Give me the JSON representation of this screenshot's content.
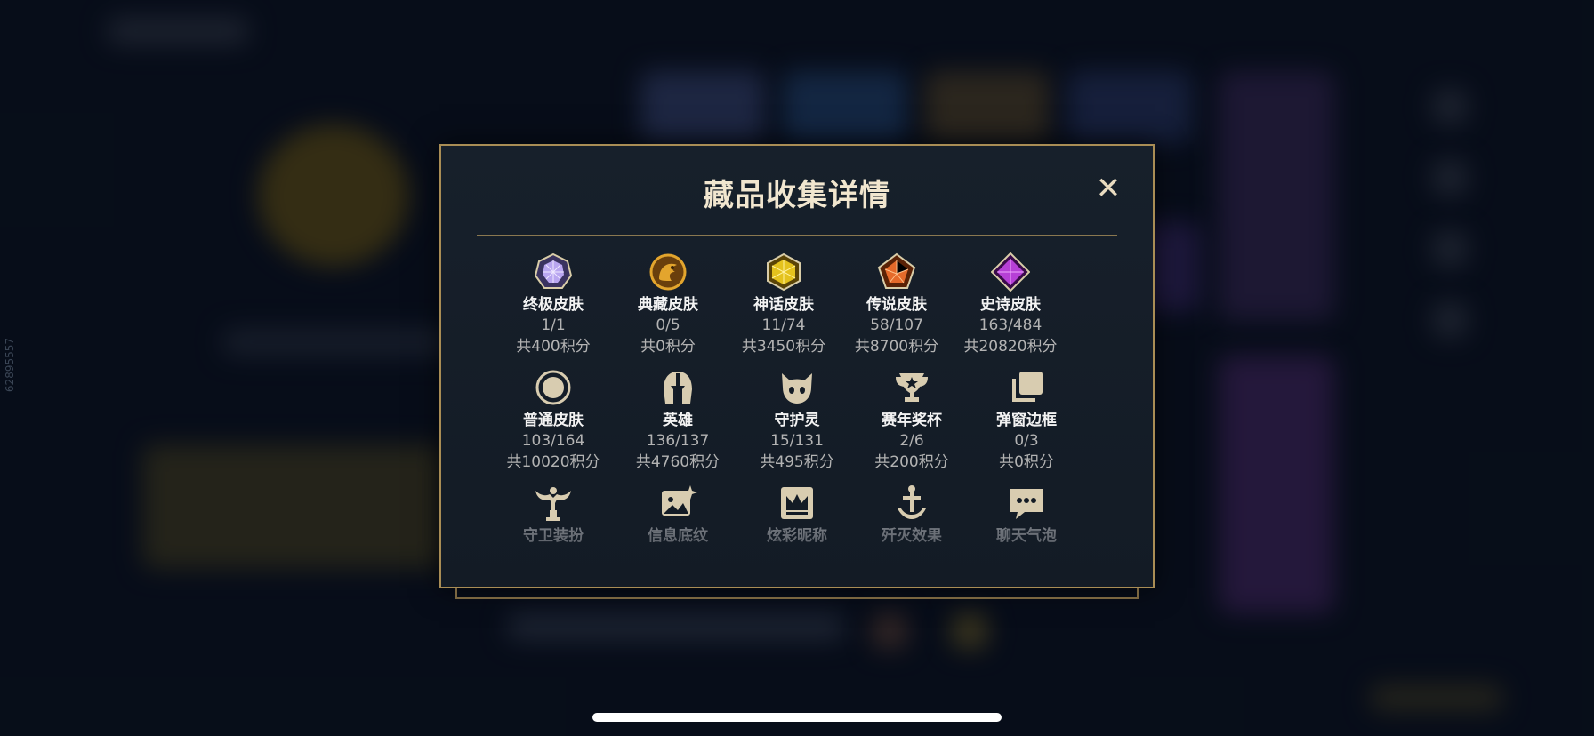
{
  "modal": {
    "title": "藏品收集详情",
    "close_label": "✕"
  },
  "collections": [
    {
      "name": "终极皮肤",
      "count": "1/1",
      "points": "共400积分",
      "icon": "ultimate-skin-icon",
      "color": "#b9a6f0"
    },
    {
      "name": "典藏皮肤",
      "count": "0/5",
      "points": "共0积分",
      "icon": "dragon-emblem-icon",
      "color": "#e3a52d"
    },
    {
      "name": "神话皮肤",
      "count": "11/74",
      "points": "共3450积分",
      "icon": "mythic-gem-icon",
      "color": "#e4c21d"
    },
    {
      "name": "传说皮肤",
      "count": "58/107",
      "points": "共8700积分",
      "icon": "legendary-gem-icon",
      "color": "#e56a2a"
    },
    {
      "name": "史诗皮肤",
      "count": "163/484",
      "points": "共20820积分",
      "icon": "epic-gem-icon",
      "color": "#b640d6"
    },
    {
      "name": "普通皮肤",
      "count": "103/164",
      "points": "共10020积分",
      "icon": "standard-ring-icon",
      "color": "#d8ccb0"
    },
    {
      "name": "英雄",
      "count": "136/137",
      "points": "共4760积分",
      "icon": "helmet-icon",
      "color": "#d8ccb0"
    },
    {
      "name": "守护灵",
      "count": "15/131",
      "points": "共495积分",
      "icon": "little-legend-icon",
      "color": "#d8ccb0"
    },
    {
      "name": "赛年奖杯",
      "count": "2/6",
      "points": "共200积分",
      "icon": "trophy-icon",
      "color": "#d8ccb0"
    },
    {
      "name": "弹窗边框",
      "count": "0/3",
      "points": "共0积分",
      "icon": "frame-stack-icon",
      "color": "#d8ccb0"
    },
    {
      "name": "守卫装扮",
      "icon": "ward-icon",
      "color": "#d8ccb0"
    },
    {
      "name": "信息底纹",
      "icon": "banner-image-icon",
      "color": "#d8ccb0"
    },
    {
      "name": "炫彩昵称",
      "icon": "crown-nameplate-icon",
      "color": "#d8ccb0"
    },
    {
      "name": "歼灭效果",
      "icon": "sword-icon",
      "color": "#d8ccb0"
    },
    {
      "name": "聊天气泡",
      "icon": "chat-bubble-icon",
      "color": "#d8ccb0"
    }
  ],
  "background": {
    "side_id": "62895557"
  },
  "colors": {
    "gold_border": "#a98d55",
    "modal_bg": "#17202b"
  }
}
